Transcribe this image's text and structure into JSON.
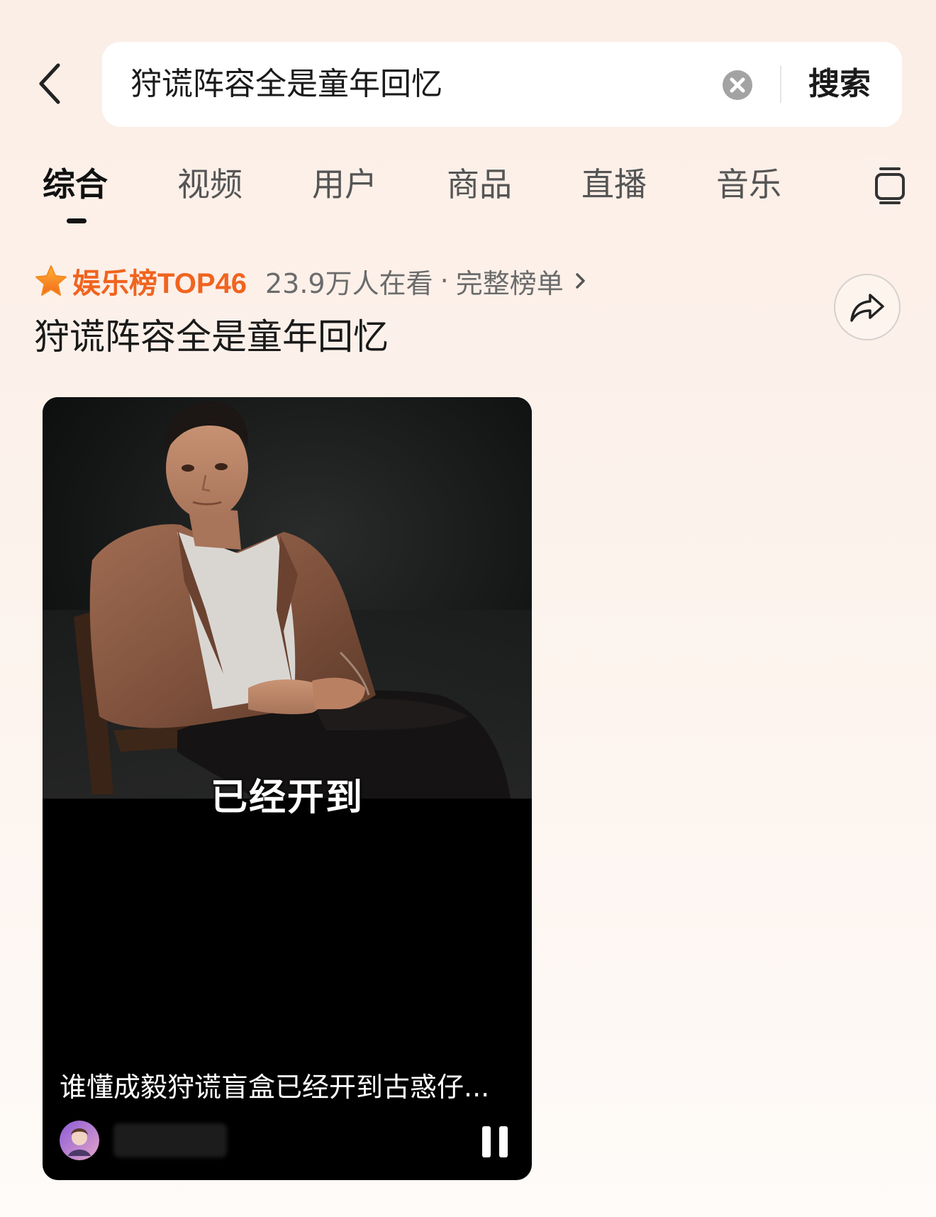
{
  "search": {
    "query": "狩谎阵容全是童年回忆",
    "submit_label": "搜索"
  },
  "tabs": [
    {
      "label": "综合",
      "active": true
    },
    {
      "label": "视频",
      "active": false
    },
    {
      "label": "用户",
      "active": false
    },
    {
      "label": "商品",
      "active": false
    },
    {
      "label": "直播",
      "active": false
    },
    {
      "label": "音乐",
      "active": false
    }
  ],
  "rank": {
    "label": "娱乐榜TOP46",
    "views": "23.9万人在看",
    "separator": "·",
    "full_list": "完整榜单",
    "accent_color": "#f0641f"
  },
  "topic": {
    "title": "狩谎阵容全是童年回忆"
  },
  "video": {
    "subtitle": "已经开到",
    "caption": "谁懂成毅狩谎盲盒已经开到古惑仔...",
    "playing": true
  },
  "icons": {
    "back": "chevron-left-icon",
    "clear": "clear-circle-icon",
    "more_tabs": "tabs-menu-icon",
    "rank": "star-icon",
    "share": "share-arrow-icon",
    "pause": "pause-icon"
  }
}
